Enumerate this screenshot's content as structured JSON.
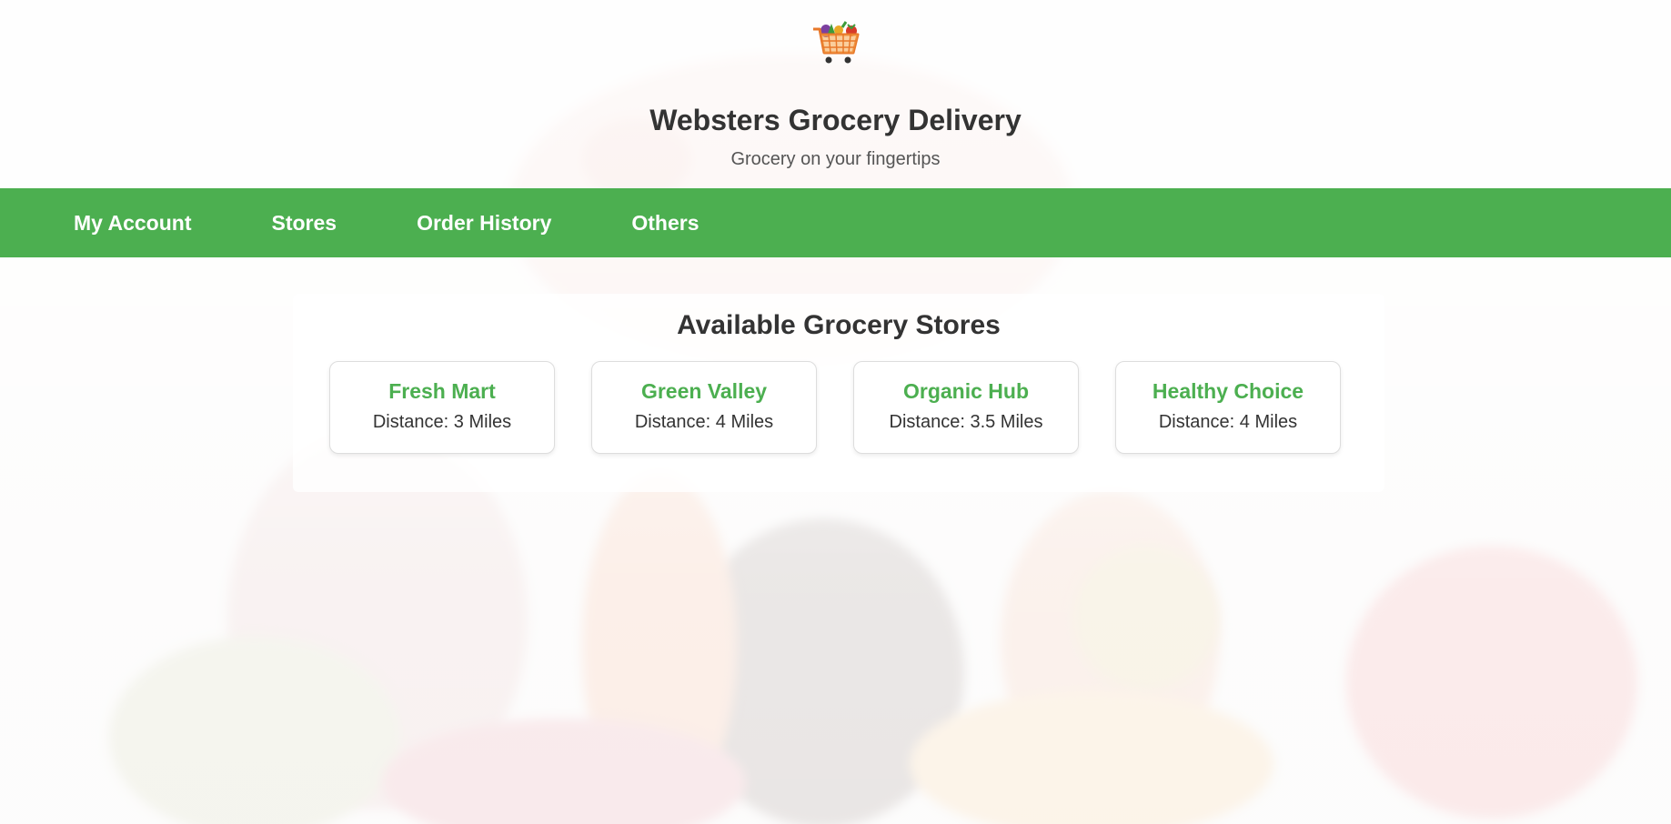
{
  "site": {
    "title": "Websters Grocery Delivery",
    "tagline": "Grocery on your fingertips",
    "logo_icon": "shopping-cart-with-produce-icon"
  },
  "nav": {
    "items": [
      {
        "label": "My Account"
      },
      {
        "label": "Stores"
      },
      {
        "label": "Order History"
      },
      {
        "label": "Others"
      }
    ]
  },
  "stores": {
    "heading": "Available Grocery Stores",
    "items": [
      {
        "name": "Fresh Mart",
        "distance": "Distance: 3 Miles"
      },
      {
        "name": "Green Valley",
        "distance": "Distance: 4 Miles"
      },
      {
        "name": "Organic Hub",
        "distance": "Distance: 3.5 Miles"
      },
      {
        "name": "Healthy Choice",
        "distance": "Distance: 4 Miles"
      }
    ]
  },
  "colors": {
    "accent": "#4caf50",
    "text": "#333333",
    "nav_text": "#ffffff"
  }
}
